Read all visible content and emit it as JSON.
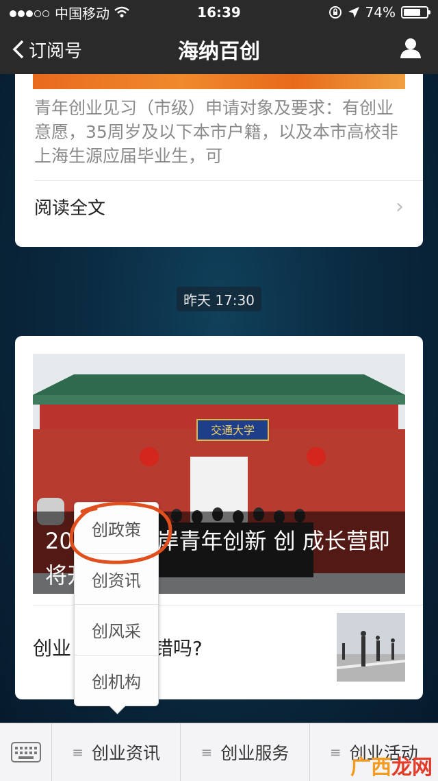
{
  "status_bar": {
    "carrier": "中国移动",
    "time": "16:39",
    "battery": "74%",
    "battery_level": 0.74
  },
  "nav": {
    "back_label": "订阅号",
    "title": "海纳百创"
  },
  "article_card_1": {
    "summary": "青年创业见习（市级）申请对象及要求：有创业意愿，35周岁及以下本市户籍，以及本市高校非上海生源应届毕业生，可",
    "read_more": "阅读全文"
  },
  "timestamp": "昨天 17:30",
  "article_card_2": {
    "hero_title_visible": "20 峡杯”两岸青年创新 创 成长营即将开始！",
    "hero_sign_text": "交通大学",
    "second_article_title_visible": "创业 是老板的错吗?"
  },
  "popup_menu": {
    "items": [
      "创政策",
      "创资讯",
      "创风采",
      "创机构"
    ],
    "highlighted_index": 0
  },
  "bottom_menu": {
    "items": [
      {
        "label": "创业资讯",
        "icon": "menu-lines-icon"
      },
      {
        "label": "创业服务",
        "icon": "menu-lines-icon"
      },
      {
        "label": "创业活动",
        "icon": "menu-lines-icon"
      }
    ]
  },
  "watermark": {
    "part1": "广西",
    "part2": "龙网"
  },
  "colors": {
    "bar_bg": "#2a2a2a",
    "highlight_ring": "#e0501e",
    "watermark_orange": "#f29b1f",
    "watermark_red": "#e23b27"
  }
}
